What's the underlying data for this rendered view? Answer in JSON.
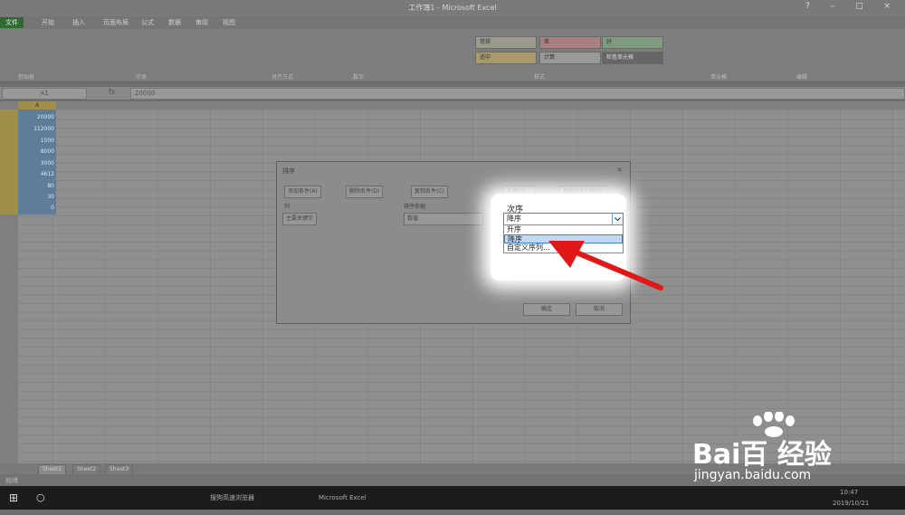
{
  "window": {
    "title": "工作簿1 - Microsoft Excel",
    "controls": "?  –  □  ×"
  },
  "ribbon": {
    "file_tab": "文件",
    "tabs": [
      "开始",
      "插入",
      "页面布局",
      "公式",
      "数据",
      "审阅",
      "视图"
    ],
    "groups": [
      "剪贴板",
      "字体",
      "对齐方式",
      "数字",
      "样式",
      "单元格",
      "编辑"
    ],
    "styles": [
      "常规",
      "差",
      "好",
      "适中",
      "计算",
      "检查单元格"
    ]
  },
  "formula_bar": {
    "name_box": "A1",
    "fx": "fx",
    "value": "20000"
  },
  "sheet": {
    "selected_col_header": "A",
    "values": [
      "20000",
      "112000",
      "1500",
      "8000",
      "3000",
      "4612",
      "80",
      "30",
      "0"
    ]
  },
  "sheet_tabs": [
    "Sheet1",
    "Sheet2",
    "Sheet3"
  ],
  "status": "就绪",
  "dialog": {
    "title": "排序",
    "close": "×",
    "toolbar": [
      "添加条件(A)",
      "删除条件(D)",
      "复制条件(C)",
      "选项(O)...",
      "数据包含标题(H)"
    ],
    "col_label": "列",
    "sortby_label": "排序依据",
    "primary_key": "主要关键字",
    "sort_on": "数值",
    "ok": "确定",
    "cancel": "取消",
    "order_label": "次序",
    "order_value": "降序",
    "order_options": [
      "升序",
      "降序",
      "自定义序列..."
    ]
  },
  "taskbar": {
    "apps": [
      "搜狗高速浏览器",
      "Microsoft Excel"
    ],
    "time": "10:47",
    "date": "2019/10/21"
  },
  "watermark": {
    "brand": "Bai百 经验",
    "url": "jingyan.baidu.com"
  },
  "colors": {
    "accent_arrow": "#e01818",
    "selection": "#c1d9f3"
  }
}
